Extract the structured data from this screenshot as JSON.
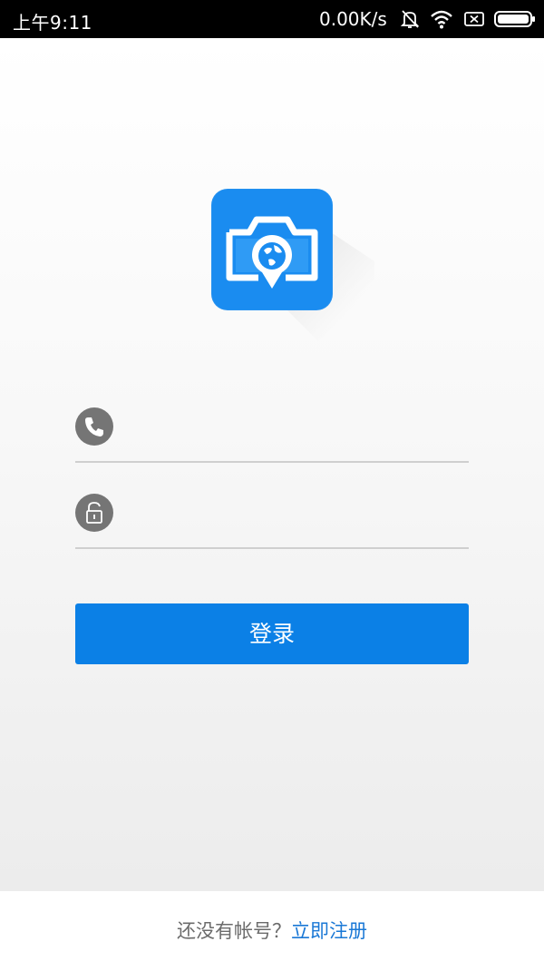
{
  "status_bar": {
    "time": "上午9:11",
    "network_speed": "0.00K/s",
    "icons": [
      "mute-icon",
      "wifi-icon",
      "sim-icon",
      "battery-icon"
    ]
  },
  "app": {
    "logo_icon": "camera-globe-icon",
    "accent_color": "#0b80e6"
  },
  "form": {
    "phone_icon": "phone-icon",
    "phone_placeholder": "",
    "password_icon": "lock-icon",
    "password_placeholder": "",
    "login_label": "登录"
  },
  "footer": {
    "question": "还没有帐号？",
    "register_link": "立即注册"
  }
}
